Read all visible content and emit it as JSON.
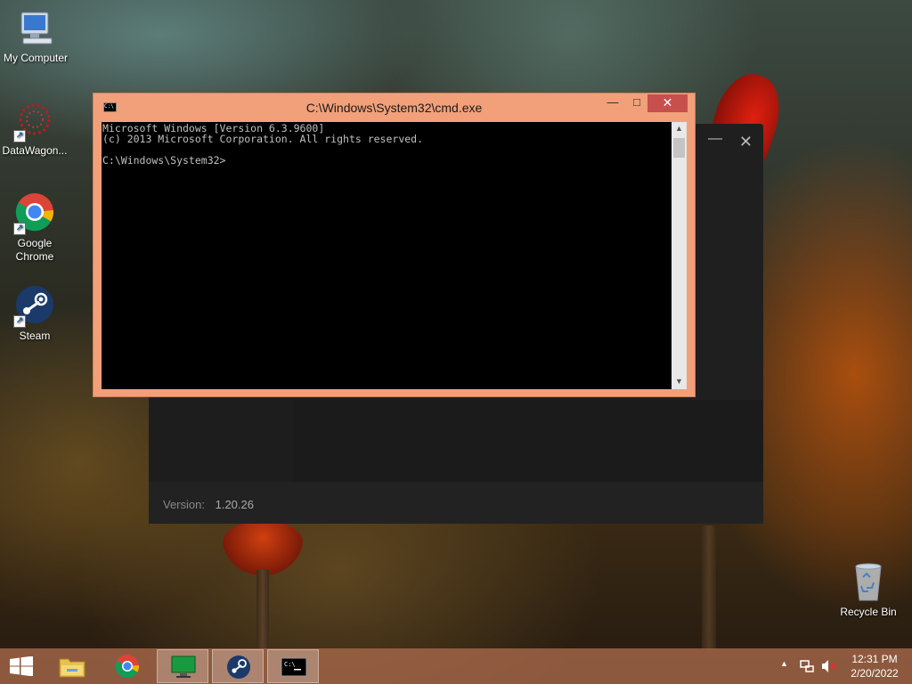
{
  "desktop": {
    "icons": [
      {
        "label": "My Computer",
        "icon": "computer-icon"
      },
      {
        "label": "DataWagon...",
        "icon": "datawagon-icon"
      },
      {
        "label": "Google Chrome",
        "icon": "chrome-icon"
      },
      {
        "label": "Steam",
        "icon": "steam-icon"
      },
      {
        "label": "Recycle Bin",
        "icon": "recycle-bin-icon"
      }
    ]
  },
  "background_app": {
    "version_label": "Version:",
    "version_value": "1.20.26",
    "close_glyph": "✕",
    "minimize_glyph": "—"
  },
  "cmd": {
    "title": "C:\\Windows\\System32\\cmd.exe",
    "icon_text": "C:\\",
    "console_text": "Microsoft Windows [Version 6.3.9600]\n(c) 2013 Microsoft Corporation. All rights reserved.\n\nC:\\Windows\\System32>",
    "minimize_glyph": "—",
    "maximize_glyph": "□",
    "close_glyph": "✕",
    "scroll_up_glyph": "▲",
    "scroll_down_glyph": "▼"
  },
  "taskbar": {
    "items": [
      {
        "name": "file-explorer",
        "icon": "folder-icon",
        "active": false
      },
      {
        "name": "chrome",
        "icon": "chrome-icon",
        "active": false
      },
      {
        "name": "remote-desktop",
        "icon": "monitor-icon",
        "active": true
      },
      {
        "name": "steam",
        "icon": "steam-icon",
        "active": true
      },
      {
        "name": "cmd",
        "icon": "cmd-icon",
        "active": true
      }
    ],
    "tray": {
      "show_hidden_glyph": "▲"
    },
    "clock": {
      "time": "12:31 PM",
      "date": "2/20/2022"
    },
    "colors": {
      "taskbar": "#a06446",
      "cmd_frame": "#f2a07a",
      "close_button": "#c7504d"
    }
  }
}
